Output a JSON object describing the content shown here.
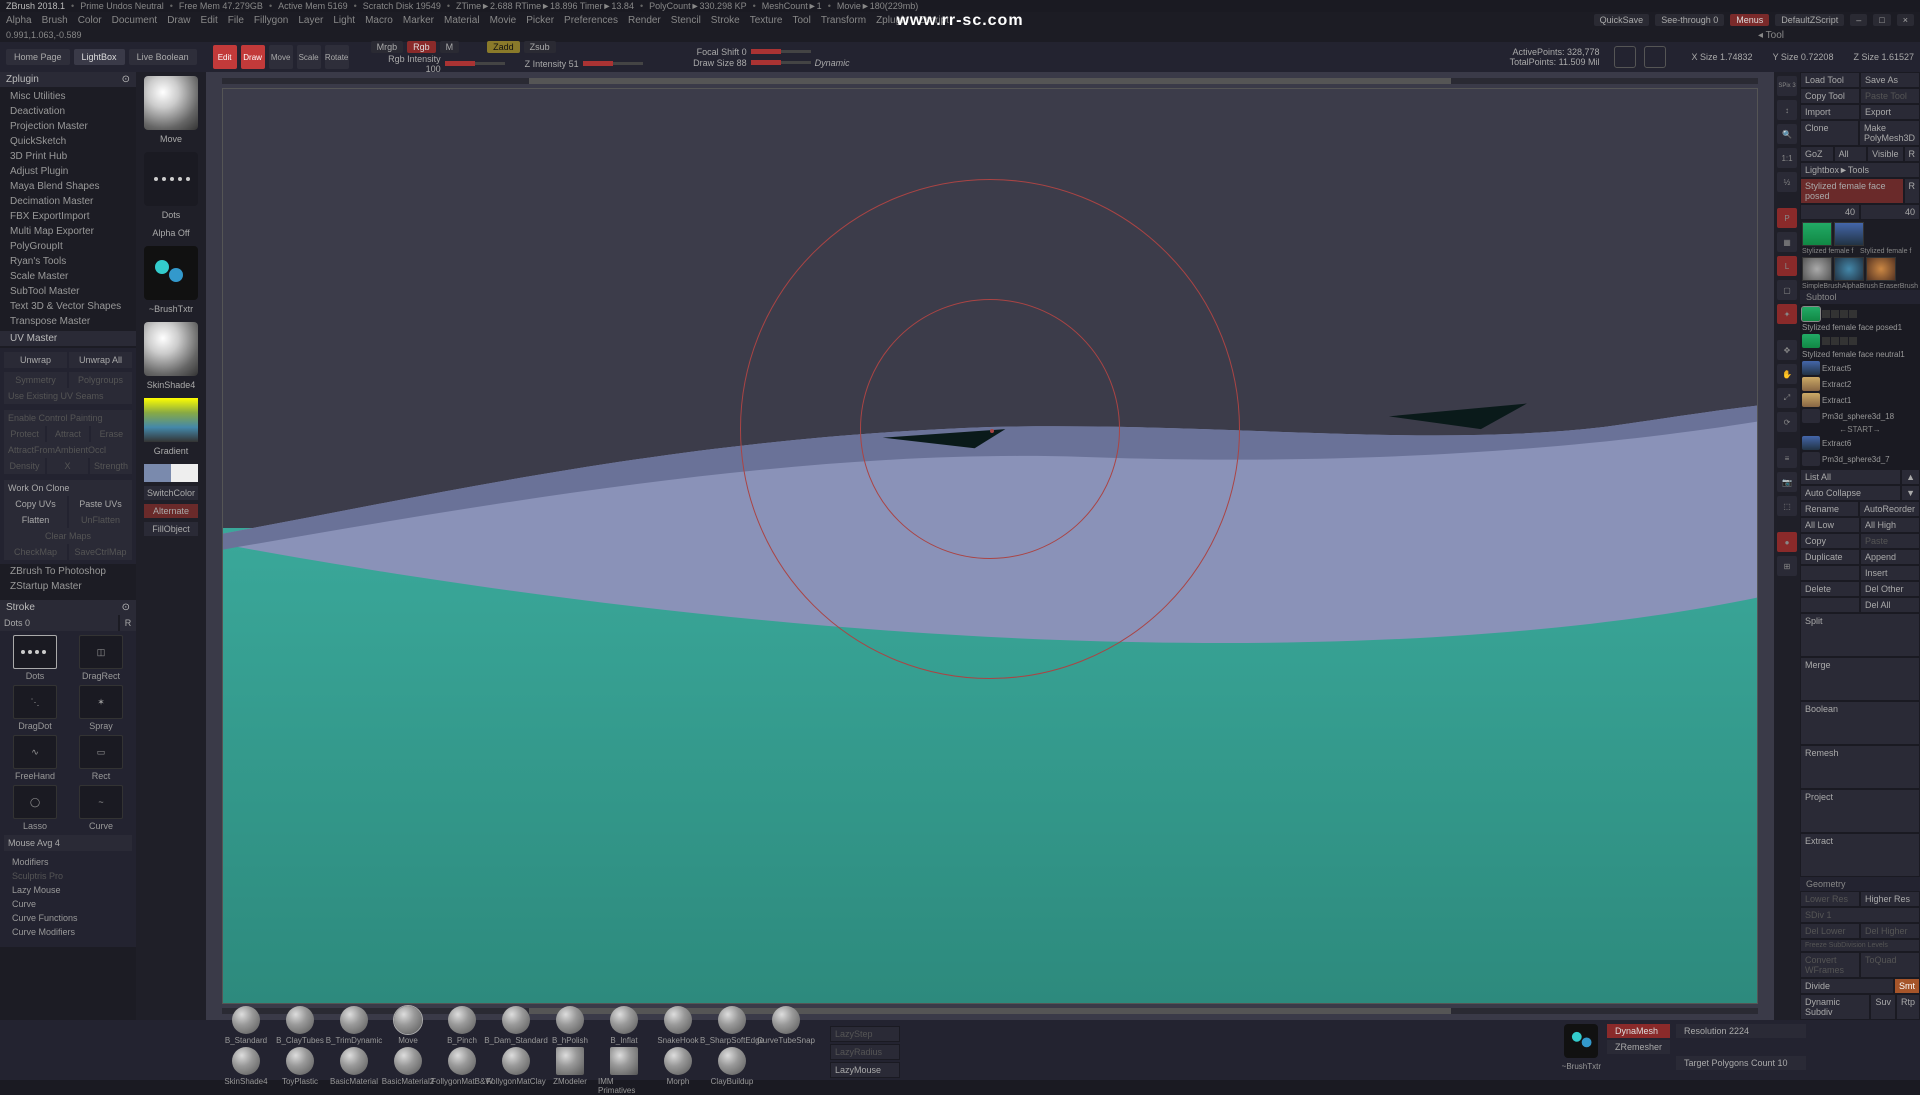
{
  "title": {
    "app": "ZBrush 2018.1",
    "segs": [
      "Prime Undos Neutral",
      "Free Mem 47.279GB",
      "Active Mem 5169",
      "Scratch Disk 19549",
      "ZTime►2.688 RTime►18.896 Timer►13.84",
      "PolyCount►330.298 KP",
      "MeshCount►1",
      "Movie►180(229mb)"
    ]
  },
  "watermark": "www.rr-sc.com",
  "menu": [
    "Alpha",
    "Brush",
    "Color",
    "Document",
    "Draw",
    "Edit",
    "File",
    "Fillygon",
    "Layer",
    "Light",
    "Macro",
    "Marker",
    "Material",
    "Movie",
    "Picker",
    "Preferences",
    "Render",
    "Stencil",
    "Stroke",
    "Texture",
    "Tool",
    "Transform",
    "Zplugin",
    "Zscript"
  ],
  "menuRight": {
    "qs": "QuickSave",
    "see": "See-through  0",
    "menus": "Menus",
    "dz": "DefaultZScript"
  },
  "info": "0.991,1.063,-0.589",
  "topbar": {
    "home": "Home Page",
    "lightbox": "LightBox",
    "live": "Live Boolean",
    "edit": "Edit",
    "draw": "Draw",
    "move": "Move",
    "scale": "Scale",
    "rotate": "Rotate",
    "mrgb": "Mrgb",
    "rgb": "Rgb",
    "m": "M",
    "zadd": "Zadd",
    "zsub": "Zsub",
    "rgbint": "Rgb Intensity 100",
    "zint": "Z Intensity 51",
    "focal": "Focal Shift 0",
    "drawsize": "Draw Size  88",
    "dyn": "Dynamic",
    "ap": "ActivePoints: 328,778",
    "tp": "TotalPoints: 11.509 Mil",
    "xs": "X Size 1.74832",
    "ys": "Y Size 0.72208",
    "zs": "Z Size 1.61527"
  },
  "zplugin": {
    "title": "Zplugin",
    "items": [
      "Misc Utilities",
      "Deactivation",
      "Projection Master",
      "QuickSketch",
      "3D Print Hub",
      "Adjust Plugin",
      "Maya Blend Shapes",
      "Decimation Master",
      "FBX ExportImport",
      "Multi Map Exporter",
      "PolyGroupIt",
      "Ryan's Tools",
      "Scale Master",
      "SubTool Master",
      "Text 3D & Vector Shapes",
      "Transpose Master"
    ],
    "uvmaster": "UV Master",
    "unwrap": "Unwrap",
    "unwrapAll": "Unwrap All",
    "sym": "Symmetry",
    "pg": "Polygroups",
    "seams": "Use Existing UV Seams",
    "ecp": "Enable Control Painting",
    "protect": "Protect",
    "attract": "Attract",
    "erase": "Erase",
    "afa": "AttractFromAmbientOccl",
    "density": "Density",
    "x": "X",
    "strength": "Strength",
    "woc": "Work On Clone",
    "cuv": "Copy UVs",
    "puv": "Paste UVs",
    "flat": "Flatten",
    "unflat": "UnFlatten",
    "cm": "Clear Maps",
    "ctm": "CheckMap",
    "sctm": "SaveCtrlMap",
    "zp": "ZBrush To Photoshop",
    "zs": "ZStartup Master"
  },
  "stroke": {
    "title": "Stroke",
    "dots": "Dots  0",
    "r": "R",
    "cells": [
      "Dots",
      "Dots",
      "DragDot",
      "Spray",
      "FreeHand",
      "Rect",
      "Lasso",
      "Curve",
      "DragRect"
    ],
    "ma": "Mouse Avg 4",
    "opts": [
      "Modifiers",
      "Sculptris Pro",
      "Lazy Mouse",
      "Curve",
      "Curve Functions",
      "Curve Modifiers"
    ]
  },
  "brushcol": {
    "move": "Move",
    "dots": "Dots",
    "alpha": "Alpha Off",
    "bt": "~BrushTxtr",
    "ss": "SkinShade4",
    "grad": "Gradient",
    "sc": "SwitchColor",
    "alt": "Alternate",
    "fill": "FillObject"
  },
  "rside": [
    "SPix 3",
    "Scroll",
    "Zoom",
    "Actual",
    "AAHalf",
    "Persp",
    "Floor",
    "Local",
    "LineFill",
    "CamW",
    "SwID"
  ],
  "tool": {
    "title": "Tool",
    "load": "Load Tool",
    "save": "Save As",
    "copy": "Copy Tool",
    "paste": "Paste Tool",
    "import": "Import",
    "export": "Export",
    "clone": "Clone",
    "mpm": "Make PolyMesh3D",
    "goz": "GoZ",
    "all": "All",
    "vis": "Visible",
    "r": "R",
    "lbt": "Lightbox►Tools",
    "cur": "Stylized female face posed",
    "n40": "40",
    "thumbs": [
      "Stylized female f",
      "Stylized female f",
      "SimpleBrush",
      "AlphaBrush",
      "EraserBrush"
    ]
  },
  "subtool": {
    "title": "Subtool",
    "items": [
      {
        "n": "Stylized female face posed1"
      },
      {
        "n": "Stylized female face neutral1"
      },
      {
        "n": "Extract5"
      },
      {
        "n": "Extract2"
      },
      {
        "n": "Extract1"
      },
      {
        "n": "Pm3d_sphere3d_18"
      },
      {
        "n": "Extract6"
      },
      {
        "n": "Pm3d_sphere3d_7"
      }
    ],
    "start": "←START→",
    "list": "List All",
    "ac": "Auto Collapse",
    "rename": "Rename",
    "ar": "AutoReorder",
    "al": "All Low",
    "ah": "All High",
    "copy": "Copy",
    "paste": "Paste",
    "dup": "Duplicate",
    "app": "Append",
    "ins": "Insert",
    "del": "Delete",
    "do": "Del Other",
    "da": "Del All",
    "ops": [
      "Split",
      "Merge",
      "Boolean",
      "Remesh",
      "Project",
      "Extract"
    ]
  },
  "geo": {
    "title": "Geometry",
    "lr": "Lower Res",
    "hr": "Higher Res",
    "div": "Divide",
    "dyn": "Dynamic Subdiv",
    "dl": "Del Lower",
    "dh": "Del Higher",
    "fm": "Freeze SubDivision Levels",
    "cw": "Convert WFrames",
    "toq": "ToQuad",
    "sdiv": "SDiv  1",
    "smt": "Smt",
    "suv": "Suv",
    "rtp": "Rtp"
  },
  "shelf": {
    "brushes": [
      "B_Standard",
      "B_ClayTubes",
      "B_TrimDynamic",
      "Move",
      "B_Pinch",
      "B_Dam_Standard",
      "B_hPolish",
      "B_Inflat",
      "SnakeHook",
      "B_SharpSoftEdge",
      "CurveTubeSnap"
    ],
    "mats": [
      "SkinShade4",
      "ToyPlastic",
      "BasicMaterial",
      "BasicMaterial2",
      "FollygonMatB&W",
      "FollygonMatClay",
      "ZModeler",
      "IMM Primatives",
      "Morph",
      "ClayBuildup"
    ],
    "lazy": "LazyStep",
    "lrad": "LazyRadius",
    "lm": "LazyMouse",
    "bt": "~BrushTxtr",
    "dm": "DynaMesh",
    "res": "Resolution  2224",
    "zr": "ZRemesher",
    "tpc": "Target Polygons Count  10"
  }
}
